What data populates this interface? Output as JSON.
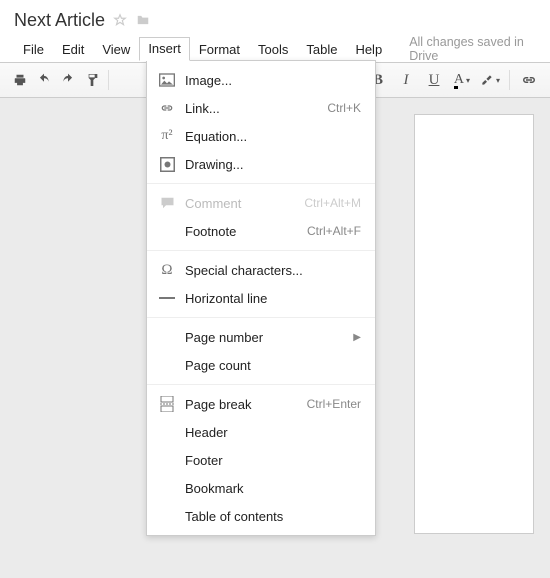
{
  "doc": {
    "title": "Next Article"
  },
  "menubar": {
    "file": "File",
    "edit": "Edit",
    "view": "View",
    "insert": "Insert",
    "format": "Format",
    "tools": "Tools",
    "table": "Table",
    "help": "Help",
    "save_status": "All changes saved in Drive"
  },
  "toolbar": {
    "bold": "B",
    "italic": "I",
    "underline": "U",
    "textcolor": "A",
    "highlight": "A"
  },
  "insert_menu": {
    "image": "Image...",
    "link": "Link...",
    "link_shortcut": "Ctrl+K",
    "equation": "Equation...",
    "drawing": "Drawing...",
    "comment": "Comment",
    "comment_shortcut": "Ctrl+Alt+M",
    "footnote": "Footnote",
    "footnote_shortcut": "Ctrl+Alt+F",
    "special_chars": "Special characters...",
    "hline": "Horizontal line",
    "page_number": "Page number",
    "page_count": "Page count",
    "page_break": "Page break",
    "page_break_shortcut": "Ctrl+Enter",
    "header": "Header",
    "footer": "Footer",
    "bookmark": "Bookmark",
    "toc": "Table of contents"
  }
}
